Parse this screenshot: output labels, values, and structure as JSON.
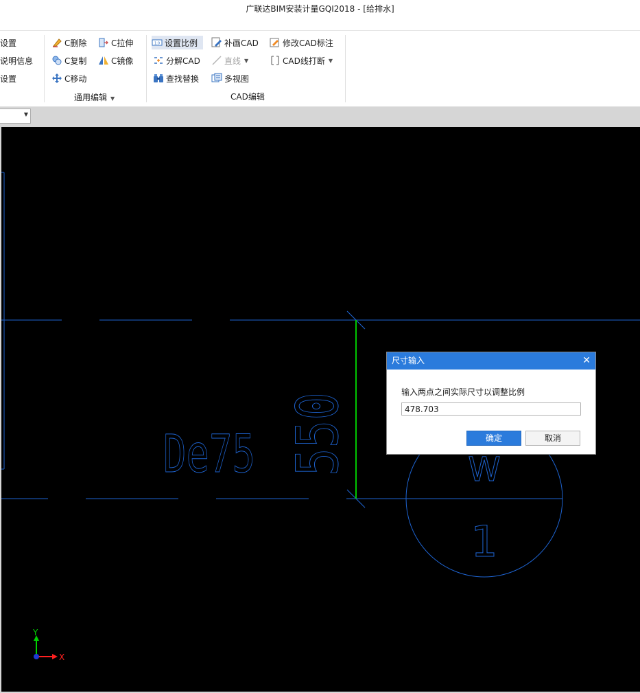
{
  "window": {
    "title": "广联达BIM安装计量GQI2018 - [给排水]"
  },
  "ribbon": {
    "left_partial_items": [
      "设置",
      "说明信息",
      "设置"
    ],
    "general_edit": {
      "label": "通用编辑",
      "items": [
        "C删除",
        "C复制",
        "C移动",
        "C拉伸",
        "C镜像"
      ]
    },
    "cad_edit": {
      "label": "CAD编辑",
      "set_scale": "设置比例",
      "explode_cad": "分解CAD",
      "find_replace": "查找替换",
      "draw_cad": "补画CAD",
      "line": "直线",
      "multi_view": "多视图",
      "modify_dim": "修改CAD标注",
      "break_line": "CAD线打断"
    }
  },
  "canvas": {
    "background": "#000000",
    "line_color": "#1e64d2",
    "measure_color": "#00c800",
    "text_pipe_label": "De75",
    "text_dimension": "550",
    "text_circle_upper": "W",
    "text_circle_lower": "1",
    "axis_x": "X",
    "axis_y": "Y"
  },
  "dialog": {
    "title": "尺寸输入",
    "close_symbol": "✕",
    "prompt": "输入两点之间实际尺寸以调整比例",
    "value": "478.703",
    "ok": "确定",
    "cancel": "取消"
  }
}
